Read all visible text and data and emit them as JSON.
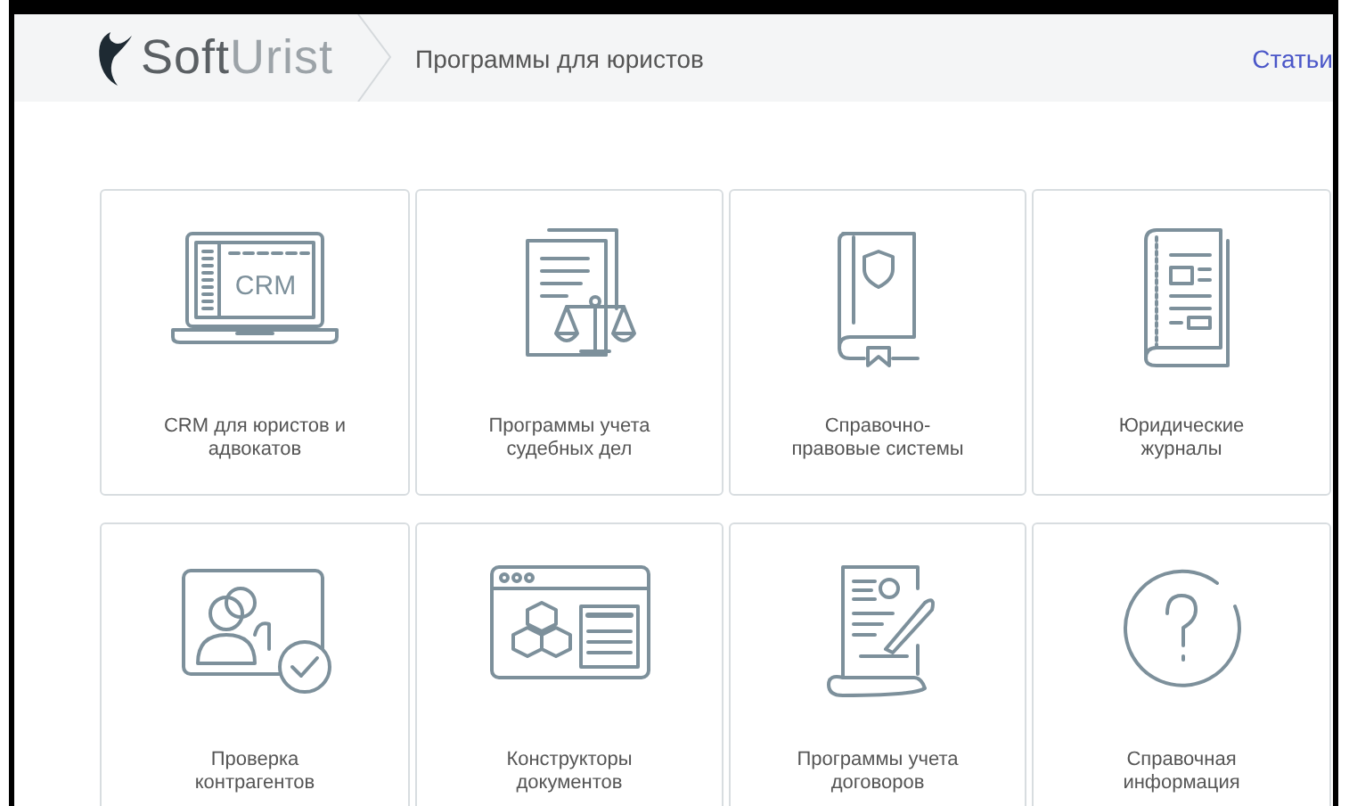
{
  "header": {
    "logo": [
      "Soft",
      "Urist"
    ],
    "section_title": "Программы для юристов",
    "nav_link": "Статьи"
  },
  "cards": [
    {
      "kind": "laptop",
      "label": "CRM для юристов и адвокатов",
      "icon_text": "CRM"
    },
    {
      "kind": "scales",
      "label": "Программы учета судебных дел"
    },
    {
      "kind": "book",
      "label": "Справочно-правовые системы"
    },
    {
      "kind": "journal",
      "label": "Юридические журналы"
    },
    {
      "kind": "contacts",
      "label": "Проверка контрагентов"
    },
    {
      "kind": "constructor",
      "label": "Конструкторы документов"
    },
    {
      "kind": "contract",
      "label": "Программы учета договоров"
    },
    {
      "kind": "help",
      "label": "Справочная информация"
    }
  ]
}
